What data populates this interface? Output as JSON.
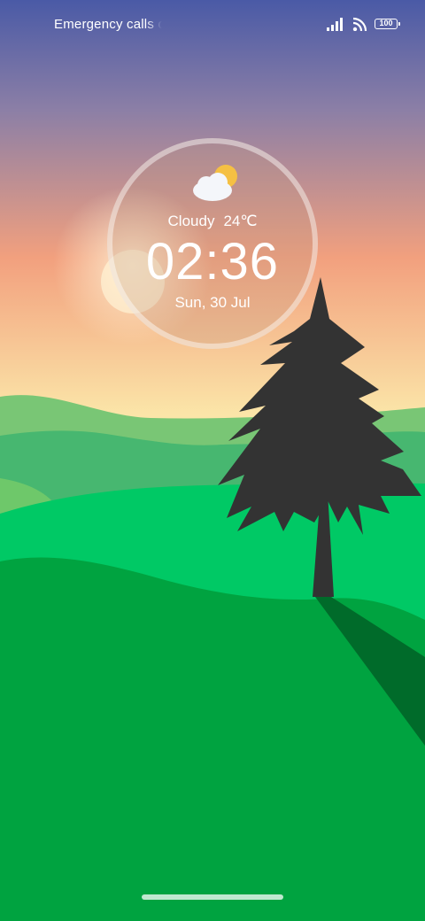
{
  "status_bar": {
    "carrier_text": "Emergency calls only",
    "battery_level": "100",
    "icons": [
      "signal-icon",
      "wifi-icon",
      "battery-icon"
    ]
  },
  "lock_widget": {
    "weather_icon": "partly-cloudy-icon",
    "condition": "Cloudy",
    "temperature": "24℃",
    "time": "02:36",
    "date": "Sun, 30 Jul"
  },
  "colors": {
    "sky_top": "#4a5aa6",
    "sky_mid": "#f2a07e",
    "sky_bottom": "#fbe5a8",
    "grass": "#00b34a",
    "tree": "#333333"
  }
}
